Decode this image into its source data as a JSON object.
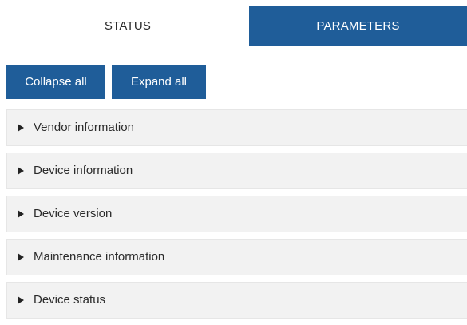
{
  "tabs": {
    "status_label": "STATUS",
    "parameters_label": "PARAMETERS",
    "active": "PARAMETERS"
  },
  "actions": {
    "collapse_label": "Collapse all",
    "expand_label": "Expand all"
  },
  "sections": [
    {
      "label": "Vendor information",
      "expanded": false
    },
    {
      "label": "Device information",
      "expanded": false
    },
    {
      "label": "Device version",
      "expanded": false
    },
    {
      "label": "Maintenance information",
      "expanded": false
    },
    {
      "label": "Device status",
      "expanded": false
    }
  ],
  "colors": {
    "accent": "#1f5d99",
    "section_bg": "#f2f2f2"
  }
}
